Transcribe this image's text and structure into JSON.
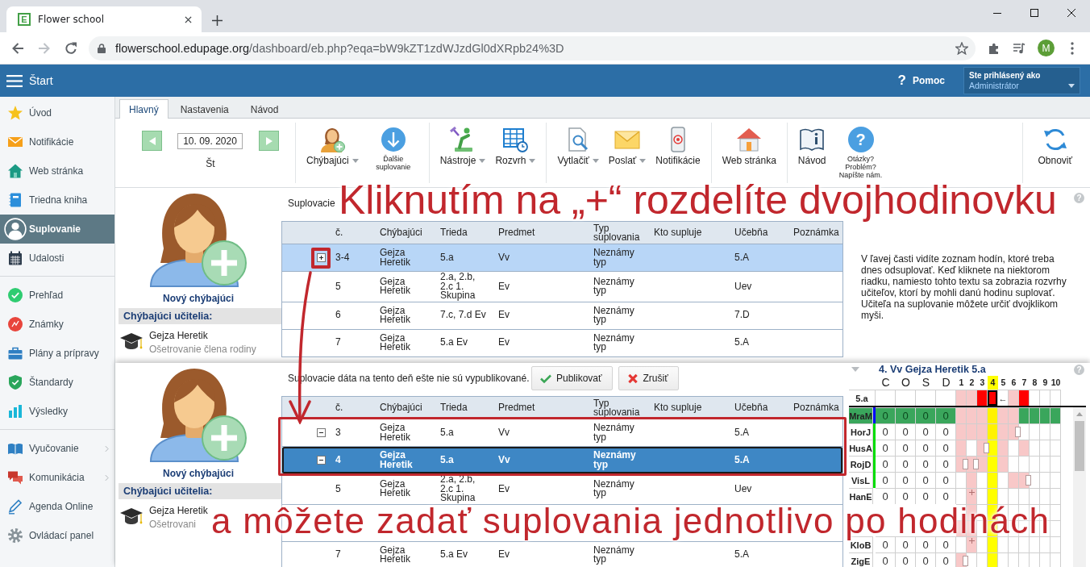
{
  "browser": {
    "tab": {
      "icon_letter": "E",
      "title": "Flower school"
    },
    "url": {
      "host": "flowerschool.edupage.org",
      "path": "/dashboard/eb.php?eqa=bW9kZT1zdWJzdGl0dXRpb24%3D"
    },
    "profile_initial": "M"
  },
  "header": {
    "title": "Štart",
    "help_mark": "?",
    "help_label": "Pomoc",
    "login_caption": "Ste prihlásený ako",
    "login_user": "Administrátor"
  },
  "sidebar": {
    "groups": [
      {
        "items": [
          {
            "label": "Úvod",
            "selected": false,
            "submenu": false
          },
          {
            "label": "Notifikácie",
            "selected": false,
            "submenu": false
          },
          {
            "label": "Web stránka",
            "selected": false,
            "submenu": false
          },
          {
            "label": "Triedna kniha",
            "selected": false,
            "submenu": false
          },
          {
            "label": "Suplovanie",
            "selected": true,
            "submenu": false
          },
          {
            "label": "Udalosti",
            "selected": false,
            "submenu": false
          }
        ]
      },
      {
        "items": [
          {
            "label": "Prehľad",
            "selected": false,
            "submenu": false
          },
          {
            "label": "Známky",
            "selected": false,
            "submenu": false
          },
          {
            "label": "Plány a prípravy",
            "selected": false,
            "submenu": false
          },
          {
            "label": "Štandardy",
            "selected": false,
            "submenu": false
          },
          {
            "label": "Výsledky",
            "selected": false,
            "submenu": false
          }
        ]
      },
      {
        "items": [
          {
            "label": "Vyučovanie",
            "selected": false,
            "submenu": true
          },
          {
            "label": "Komunikácia",
            "selected": false,
            "submenu": true
          },
          {
            "label": "Agenda Online",
            "selected": false,
            "submenu": false
          },
          {
            "label": "Ovládací panel",
            "selected": false,
            "submenu": false
          }
        ]
      }
    ]
  },
  "tabs": [
    {
      "label": "Hlavný",
      "selected": true
    },
    {
      "label": "Nastavenia",
      "selected": false
    },
    {
      "label": "Návod",
      "selected": false
    }
  ],
  "toolbar": {
    "date": "10. 09. 2020",
    "weekday": "Št",
    "groups": [
      {
        "items": [
          {
            "label": "Chýbajúci",
            "kind": "normal",
            "dropdown": true
          },
          {
            "label": "Ďalšie suplovanie",
            "kind": "compact",
            "dropdown": false
          }
        ]
      },
      {
        "items": [
          {
            "label": "Nástroje",
            "kind": "normal",
            "dropdown": true
          },
          {
            "label": "Rozvrh",
            "kind": "normal",
            "dropdown": true
          }
        ]
      },
      {
        "items": [
          {
            "label": "Vytlačiť",
            "kind": "normal",
            "dropdown": true
          },
          {
            "label": "Poslať",
            "kind": "normal",
            "dropdown": true
          },
          {
            "label": "Notifikácie",
            "kind": "normal",
            "dropdown": false
          }
        ]
      },
      {
        "items": [
          {
            "label": "Web stránka",
            "kind": "normal",
            "dropdown": false
          }
        ]
      },
      {
        "items": [
          {
            "label": "Návod",
            "kind": "normal",
            "dropdown": false
          },
          {
            "label": "Otázky? Problém? Napíšte nám.",
            "kind": "compact",
            "dropdown": false,
            "glyph": "?"
          }
        ]
      },
      {
        "items": [
          {
            "label": "Obnoviť",
            "kind": "normal",
            "dropdown": false
          }
        ]
      }
    ]
  },
  "top_panel": {
    "new_absent": "Nový chýbajúci",
    "absent_heading": "Chýbajúci učitelia:",
    "absent_teachers": [
      {
        "name": "Gejza Heretik",
        "reason": "Ošetrovanie člena rodiny"
      }
    ],
    "notice": "Suplovacie",
    "table": {
      "focused": false,
      "columns": [
        "č.",
        "Chýbajúci",
        "Trieda",
        "Predmet",
        "Typ suplovania",
        "Kto supluje",
        "Učebňa",
        "Poznámka"
      ],
      "rows": [
        {
          "selected": true,
          "expanded": false,
          "number": "3-4",
          "absent": "Gejza Heretik",
          "class": "5.a",
          "subject": "Vv",
          "type": "Neznámy typ",
          "room": "5.A"
        },
        {
          "selected": false,
          "number": "5",
          "absent": "Gejza Heretik",
          "class": "2.a, 2.b, 2.c 1. Skupina",
          "subject": "Ev",
          "type": "Neznámy typ",
          "room": "Uev"
        },
        {
          "selected": false,
          "number": "6",
          "absent": "Gejza Heretik",
          "class": "7.c, 7.d Ev",
          "subject": "Ev",
          "type": "Neznámy typ",
          "room": "7.D"
        },
        {
          "selected": false,
          "number": "7",
          "absent": "Gejza Heretik",
          "class": "5.a Ev",
          "subject": "Ev",
          "type": "Neznámy typ",
          "room": "5.A"
        }
      ]
    },
    "help_mark": "?",
    "help_text": "V ľavej časti vidíte zoznam hodín, ktoré treba dnes odsuplovať. Keď kliknete na niektorom riadku, namiesto tohto textu sa zobrazia rozvrhy učiteľov, ktorí by mohli danú hodinu suplovať. Učiteľa na suplovanie môžete určiť dvojklikom myši."
  },
  "bottom_panel": {
    "new_absent": "Nový chýbajúci",
    "absent_heading": "Chýbajúci učitelia:",
    "absent_teachers": [
      {
        "name": "Gejza Heretik",
        "reason": "Ošetrovani"
      }
    ],
    "notice": "Suplovacie dáta na tento deň ešte nie sú vypublikované.",
    "buttons": [
      {
        "kind": "publish",
        "label": "Publikovať"
      },
      {
        "kind": "cancel",
        "label": "Zrušiť"
      }
    ],
    "table": {
      "focused": true,
      "columns": [
        "č.",
        "Chýbajúci",
        "Trieda",
        "Predmet",
        "Typ suplovania",
        "Kto supluje",
        "Učebňa",
        "Poznámka"
      ],
      "rows": [
        {
          "selected": false,
          "expanded": true,
          "number": "3",
          "absent": "Gejza Heretik",
          "class": "5.a",
          "subject": "Vv",
          "type": "Neznámy typ",
          "room": "5.A"
        },
        {
          "selected": true,
          "expanded": true,
          "number": "4",
          "absent": "Gejza Heretik",
          "class": "5.a",
          "subject": "Vv",
          "type": "Neznámy typ",
          "room": "5.A"
        },
        {
          "selected": false,
          "number": "5",
          "absent": "Gejza Heretik",
          "class": "2.a, 2.b, 2.c 1. Skupina",
          "subject": "Ev",
          "type": "Neznámy typ",
          "room": "Uev"
        },
        {
          "selected": false
        },
        {
          "selected": false,
          "number": "7",
          "absent": "Gejza Heretik",
          "class": "5.a Ev",
          "subject": "Ev",
          "type": "Neznámy typ",
          "room": "5.A"
        }
      ]
    },
    "schedule": {
      "title": "4. Vv Gejza Heretik 5.a",
      "help_mark": "?",
      "days": [
        "C",
        "O",
        "S",
        "D"
      ],
      "periods": [
        {
          "label": "1",
          "selected": false
        },
        {
          "label": "2",
          "selected": false
        },
        {
          "label": "3",
          "selected": false
        },
        {
          "label": "4",
          "selected": true
        },
        {
          "label": "5",
          "selected": false
        },
        {
          "label": "6",
          "selected": false
        },
        {
          "label": "7",
          "selected": false
        },
        {
          "label": "8",
          "selected": false
        },
        {
          "label": "9",
          "selected": false
        },
        {
          "label": "10",
          "selected": false
        }
      ],
      "class_row": {
        "name": "5.a",
        "cells": [
          {
            "kind": "busy"
          },
          {
            "kind": "busy"
          },
          {
            "kind": "lesson"
          },
          {
            "kind": "lesson"
          },
          {
            "kind": "free",
            "text": "←"
          },
          {
            "kind": "busy"
          },
          {
            "kind": "lesson"
          },
          {
            "kind": "free"
          },
          {
            "kind": "free"
          },
          {
            "kind": "free"
          }
        ]
      },
      "teachers": [
        {
          "name": "MraM",
          "selected": true,
          "color": "#0000ff",
          "days": [
            "0",
            "0",
            "0",
            "0"
          ],
          "cells": [
            {
              "kind": "busy"
            },
            {
              "kind": "busy"
            },
            {
              "kind": "busy"
            },
            {
              "kind": "busy"
            },
            {
              "kind": "busy"
            },
            {
              "kind": "busy"
            },
            {
              "kind": "free"
            },
            {
              "kind": "free"
            },
            {
              "kind": "free"
            },
            {
              "kind": "free"
            }
          ]
        },
        {
          "name": "HorJ",
          "selected": false,
          "color": "#00dd00",
          "days": [
            "0",
            "0",
            "0",
            "0"
          ],
          "cells": [
            {
              "kind": "busy"
            },
            {
              "kind": "busy"
            },
            {
              "kind": "busy"
            },
            {
              "kind": "busy"
            },
            {
              "kind": "busy"
            },
            {
              "kind": "booked"
            },
            {
              "kind": "free"
            },
            {
              "kind": "free"
            },
            {
              "kind": "free"
            },
            {
              "kind": "free"
            }
          ]
        },
        {
          "name": "HusA",
          "selected": false,
          "color": "#00dd00",
          "days": [
            "0",
            "0",
            "0",
            "0"
          ],
          "cells": [
            {
              "kind": "busy"
            },
            {
              "kind": "free"
            },
            {
              "kind": "booked"
            },
            {
              "kind": "free"
            },
            {
              "kind": "busy"
            },
            {
              "kind": "free"
            },
            {
              "kind": "busy"
            },
            {
              "kind": "free"
            },
            {
              "kind": "free"
            },
            {
              "kind": "free"
            }
          ]
        },
        {
          "name": "RojD",
          "selected": false,
          "color": "#00dd00",
          "days": [
            "0",
            "0",
            "0",
            "0"
          ],
          "cells": [
            {
              "kind": "booked"
            },
            {
              "kind": "booked"
            },
            {
              "kind": "busy"
            },
            {
              "kind": "free"
            },
            {
              "kind": "busy"
            },
            {
              "kind": "free"
            },
            {
              "kind": "free"
            },
            {
              "kind": "free"
            },
            {
              "kind": "free"
            },
            {
              "kind": "free"
            }
          ]
        },
        {
          "name": "VisL",
          "selected": false,
          "color": "#00dd00",
          "days": [
            "0",
            "0",
            "0",
            "0"
          ],
          "cells": [
            {
              "kind": "free"
            },
            {
              "kind": "busy"
            },
            {
              "kind": "free"
            },
            {
              "kind": "free"
            },
            {
              "kind": "free"
            },
            {
              "kind": "busy"
            },
            {
              "kind": "booked"
            },
            {
              "kind": "free"
            },
            {
              "kind": "free"
            },
            {
              "kind": "free"
            }
          ]
        },
        {
          "name": "HanE",
          "selected": false,
          "days": [
            "0",
            "0",
            "0",
            "0"
          ],
          "cells": [
            {
              "kind": "free"
            },
            {
              "kind": "marked"
            },
            {
              "kind": "free"
            },
            {
              "kind": "free"
            },
            {
              "kind": "free"
            },
            {
              "kind": "free"
            },
            {
              "kind": "free"
            },
            {
              "kind": "free"
            },
            {
              "kind": "free"
            },
            {
              "kind": "free"
            }
          ]
        },
        {
          "selected": false,
          "cells": [
            {
              "kind": "free"
            },
            {
              "kind": "busy"
            },
            {
              "kind": "free"
            },
            {
              "kind": "free"
            },
            {
              "kind": "free"
            },
            {
              "kind": "free"
            },
            {
              "kind": "free"
            },
            {
              "kind": "free"
            },
            {
              "kind": "free"
            },
            {
              "kind": "free"
            }
          ]
        },
        {
          "selected": false,
          "cells": [
            {
              "kind": "busy"
            },
            {
              "kind": "busy"
            },
            {
              "kind": "free"
            },
            {
              "kind": "free"
            },
            {
              "kind": "free"
            },
            {
              "kind": "free"
            },
            {
              "kind": "free"
            },
            {
              "kind": "free"
            },
            {
              "kind": "free"
            },
            {
              "kind": "free"
            }
          ]
        },
        {
          "name": "KloB",
          "selected": false,
          "days": [
            "0",
            "0",
            "0",
            "0"
          ],
          "cells": [
            {
              "kind": "free"
            },
            {
              "kind": "marked"
            },
            {
              "kind": "free"
            },
            {
              "kind": "free"
            },
            {
              "kind": "free"
            },
            {
              "kind": "free"
            },
            {
              "kind": "free"
            },
            {
              "kind": "free"
            },
            {
              "kind": "free"
            },
            {
              "kind": "free"
            }
          ]
        },
        {
          "name": "ZigE",
          "selected": false,
          "days": [
            "0",
            "0",
            "0",
            "0"
          ],
          "cells": [
            {
              "kind": "booked"
            },
            {
              "kind": "free"
            },
            {
              "kind": "free"
            },
            {
              "kind": "free"
            },
            {
              "kind": "free"
            },
            {
              "kind": "free"
            },
            {
              "kind": "free"
            },
            {
              "kind": "free"
            },
            {
              "kind": "free"
            },
            {
              "kind": "free"
            }
          ]
        }
      ]
    }
  },
  "annotations": [
    {
      "text": "Kliknutím na „+“ rozdelíte dvojhodinovku"
    },
    {
      "text": "a môžete zadať suplovania jednotlivo po hodinách"
    }
  ]
}
